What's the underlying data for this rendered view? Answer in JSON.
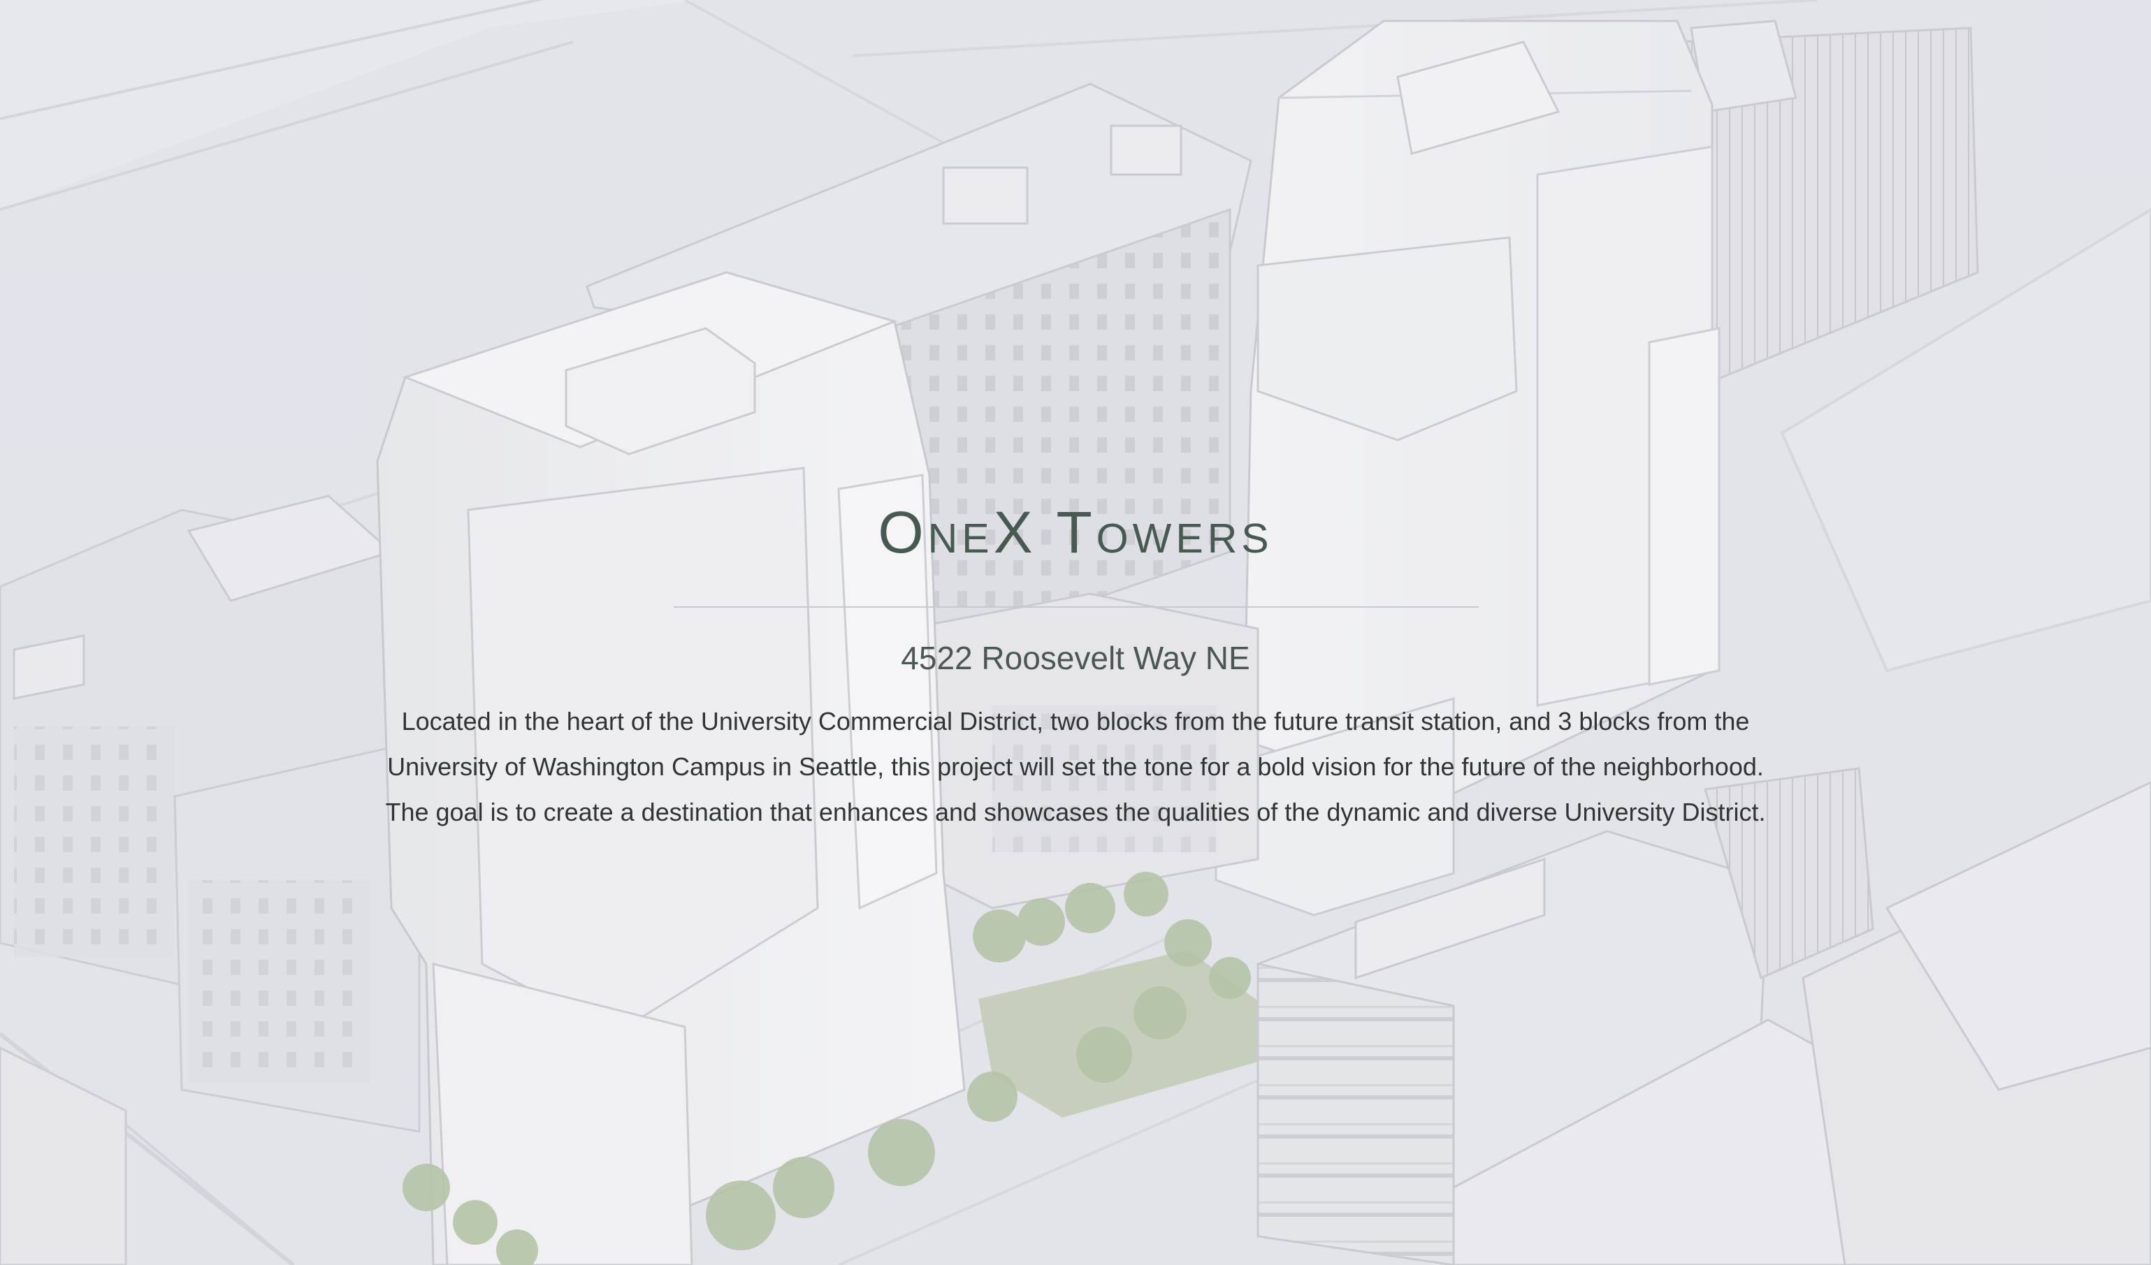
{
  "hero": {
    "title": "OneX Towers",
    "address": "4522 Roosevelt Way NE",
    "description_lines": [
      "Located in the heart of the University Commercial District, two blocks from the future transit station, and 3 blocks from the",
      "University of Washington Campus in Seattle, this project will set the tone for a bold vision for the future of the neighborhood.",
      "The goal is to create a destination that enhances and showcases the qualities of the dynamic and diverse University District."
    ]
  },
  "colors": {
    "title": "#465a52",
    "text": "#2f3533",
    "background": "#e4e5ec",
    "tree_green": "#a9bd98"
  },
  "background_image": "architectural-massing-render"
}
